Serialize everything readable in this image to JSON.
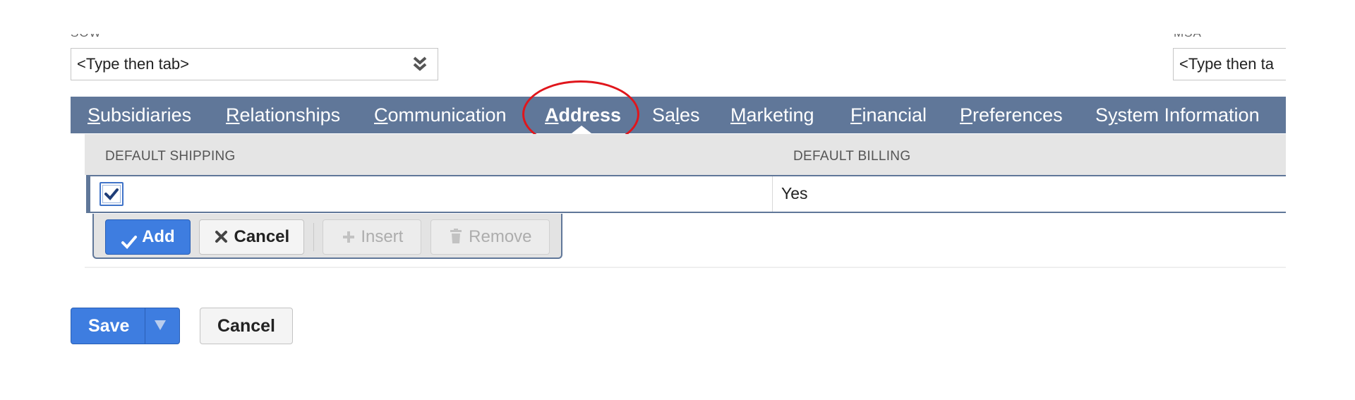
{
  "fields": {
    "sow": {
      "label": "SOW",
      "placeholder": "<Type then tab>"
    },
    "msa": {
      "label": "MSA",
      "placeholder": "<Type then ta"
    }
  },
  "tabs": [
    {
      "label": "Subsidiaries",
      "access_key": "S",
      "rest": "ubsidiaries"
    },
    {
      "label": "Relationships",
      "access_key": "R",
      "rest": "elationships"
    },
    {
      "label": "Communication",
      "access_key": "C",
      "rest": "ommunication"
    },
    {
      "label": "Address",
      "access_key": "A",
      "rest": "ddress",
      "active": true
    },
    {
      "label": "Sales",
      "pre": "Sa",
      "access_key": "l",
      "rest": "es"
    },
    {
      "label": "Marketing",
      "access_key": "M",
      "rest": "arketing"
    },
    {
      "label": "Financial",
      "access_key": "F",
      "rest": "inancial"
    },
    {
      "label": "Preferences",
      "access_key": "P",
      "rest": "references"
    },
    {
      "label": "System Information",
      "pre": "S",
      "access_key": "y",
      "rest": "stem Information"
    }
  ],
  "sublist": {
    "columns": [
      "DEFAULT SHIPPING",
      "DEFAULT BILLING"
    ],
    "edit_row": {
      "default_shipping_checked": true,
      "default_billing": "Yes"
    }
  },
  "machine_buttons": {
    "add": "Add",
    "cancel": "Cancel",
    "insert": "Insert",
    "remove": "Remove"
  },
  "form_buttons": {
    "save": "Save",
    "cancel": "Cancel"
  },
  "colors": {
    "tab_bar": "#607799",
    "primary_button": "#3e7de0",
    "highlight_circle": "#e0161c"
  },
  "icons": [
    "chevron-double-down-icon",
    "checkmark-icon",
    "x-icon",
    "plus-icon",
    "trash-icon",
    "caret-down-icon"
  ]
}
